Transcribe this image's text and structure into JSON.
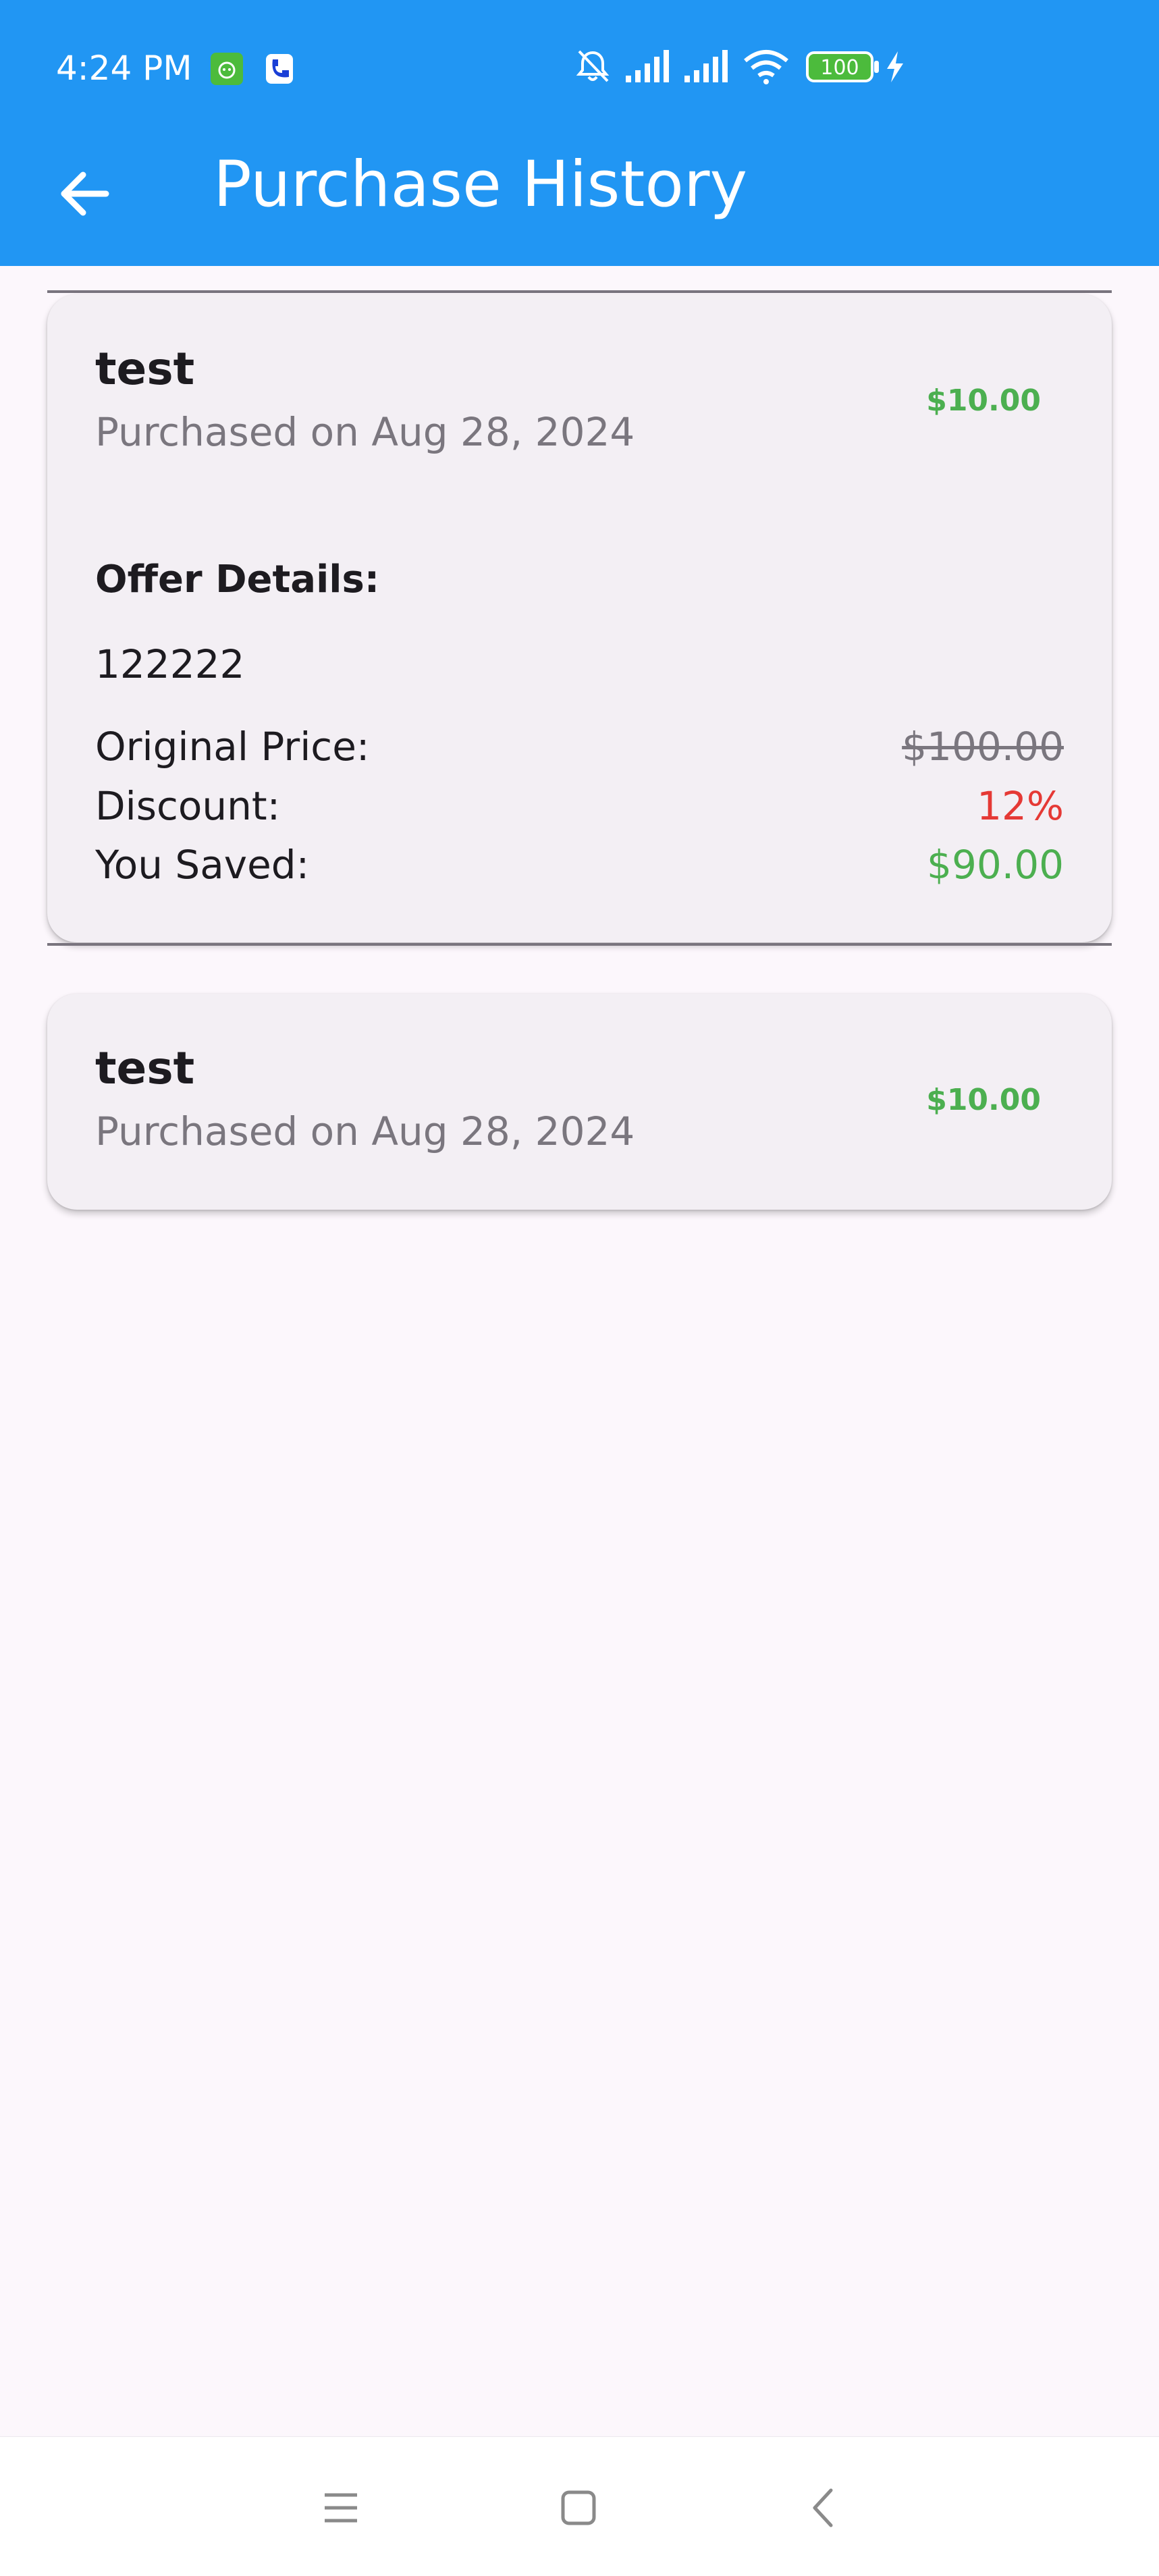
{
  "status_bar": {
    "time": "4:24 PM",
    "battery_level": "100",
    "icons": [
      "app-notification-icon",
      "phone-notification-icon",
      "bell-off-icon",
      "signal-icon",
      "signal-icon",
      "wifi-icon",
      "battery-icon",
      "charging-icon"
    ]
  },
  "app_bar": {
    "title": "Purchase History",
    "back_icon": "arrow-back-icon",
    "background_color": "#2196F3"
  },
  "purchases": [
    {
      "title": "test",
      "date": "Purchased on Aug 28, 2024",
      "price": "$10.00",
      "expanded": true,
      "offer_heading": "Offer Details:",
      "offer_description": "122222",
      "rows": [
        {
          "label": "Original Price:",
          "value": "$100.00"
        },
        {
          "label": "Discount:",
          "value": "12%"
        },
        {
          "label": "You Saved:",
          "value": "$90.00"
        }
      ]
    },
    {
      "title": "test",
      "date": "Purchased on Aug 28, 2024",
      "price": "$10.00",
      "expanded": false
    }
  ],
  "colors": {
    "price_green": "#4CAF50",
    "discount_red": "#E53935",
    "muted_text": "#7A767E"
  },
  "nav_bar": {
    "icons": [
      "menu-icon",
      "home-square-icon",
      "back-chevron-icon"
    ]
  }
}
